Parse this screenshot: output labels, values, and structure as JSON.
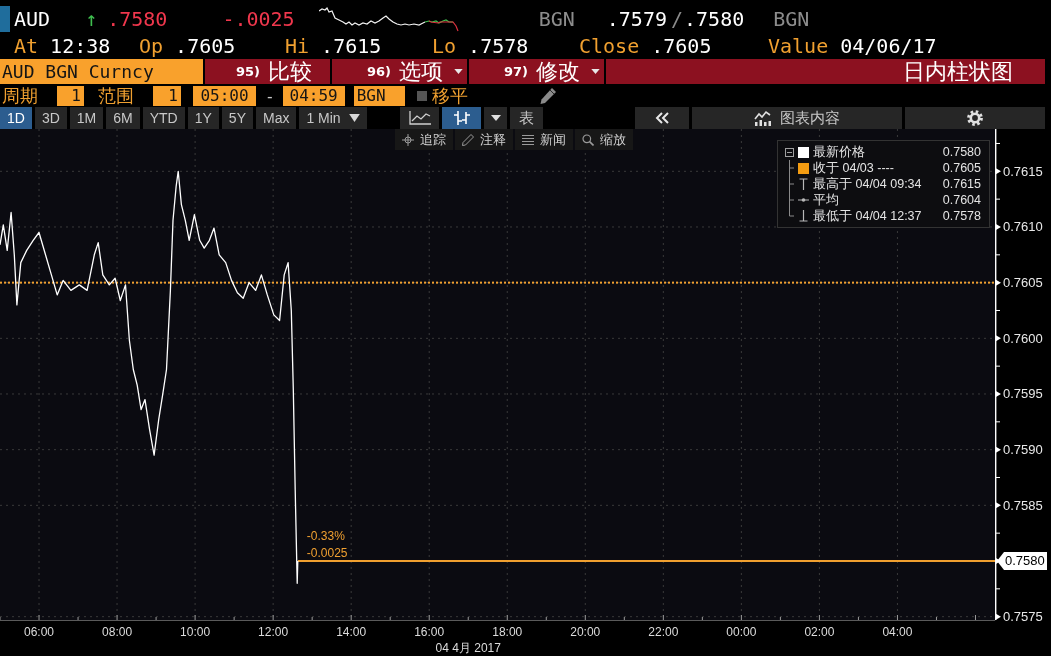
{
  "quote_header": {
    "ticker": "AUD",
    "trend_arrow": "↑",
    "last": ".7580",
    "change": "-.0025",
    "bid_source": "BGN",
    "bid": ".7579",
    "separator": "/",
    "ask": ".7580",
    "ask_source": "BGN"
  },
  "stats": [
    {
      "label": "At",
      "value": "12:38"
    },
    {
      "label": "Op",
      "value": ".7605"
    },
    {
      "label": "Hi",
      "value": ".7615"
    },
    {
      "label": "Lo",
      "value": ".7578"
    },
    {
      "label": "Close",
      "value": ".7605"
    },
    {
      "label": "Value",
      "value": "04/06/17"
    }
  ],
  "menu_bar": {
    "security": "AUD BGN Curncy",
    "actions": [
      {
        "number": "95)",
        "label": "比较",
        "dropdown": false
      },
      {
        "number": "96)",
        "label": "选项",
        "dropdown": true
      },
      {
        "number": "97)",
        "label": "修改",
        "dropdown": true
      }
    ],
    "title": "日内柱状图"
  },
  "settings_bar": {
    "period_label": "周期",
    "period": "1",
    "range_label": "范围",
    "range": "1",
    "start": "05:00",
    "separator": "-",
    "end": "04:59",
    "source": "BGN",
    "shift": {
      "label": "移平",
      "checked": false
    }
  },
  "toolbar": {
    "ranges": [
      {
        "label": "1D",
        "selected": true
      },
      {
        "label": "3D",
        "selected": false
      },
      {
        "label": "1M",
        "selected": false
      },
      {
        "label": "6M",
        "selected": false
      },
      {
        "label": "YTD",
        "selected": false
      },
      {
        "label": "1Y",
        "selected": false
      },
      {
        "label": "5Y",
        "selected": false
      },
      {
        "label": "Max",
        "selected": false
      }
    ],
    "interval": "1 Min",
    "chart_types": [
      {
        "kind": "line",
        "selected": false
      },
      {
        "kind": "bars",
        "selected": true
      }
    ],
    "table": "表",
    "panel": "图表内容"
  },
  "tools": [
    {
      "kind": "track",
      "label": "追踪"
    },
    {
      "kind": "annotate",
      "label": "注释"
    },
    {
      "kind": "news",
      "label": "新闻"
    },
    {
      "kind": "zoom",
      "label": "缩放"
    }
  ],
  "legend": {
    "kind": "swatch",
    "color": "#ffffff",
    "label": "最新价格",
    "value": "0.7580",
    "expanded": true,
    "children": [
      {
        "kind": "swatch",
        "color": "#f39c12",
        "label": "收于 04/03 ----",
        "value": "0.7605"
      },
      {
        "kind": "high",
        "label": "最高于 04/04 09:34",
        "value": "0.7615"
      },
      {
        "kind": "average",
        "label": "平均",
        "value": "0.7604"
      },
      {
        "kind": "low",
        "label": "最低于 04/04 12:37",
        "value": "0.7578"
      }
    ]
  },
  "chart": {
    "chart_data": {
      "type": "line",
      "xlabel": "04 4月 2017",
      "x": [
        "2017-04-04 05:00",
        "2017-04-04 05:05",
        "2017-04-04 05:11",
        "2017-04-04 05:17",
        "2017-04-04 05:22",
        "2017-04-04 05:26",
        "2017-04-04 05:32",
        "2017-04-04 05:41",
        "2017-04-04 05:51",
        "2017-04-04 06:00",
        "2017-04-04 06:10",
        "2017-04-04 06:19",
        "2017-04-04 06:28",
        "2017-04-04 06:37",
        "2017-04-04 06:49",
        "2017-04-04 07:02",
        "2017-04-04 07:14",
        "2017-04-04 07:25",
        "2017-04-04 07:31",
        "2017-04-04 07:38",
        "2017-04-04 07:48",
        "2017-04-04 07:57",
        "2017-04-04 08:05",
        "2017-04-04 08:13",
        "2017-04-04 08:19",
        "2017-04-04 08:25",
        "2017-04-04 08:31",
        "2017-04-04 08:37",
        "2017-04-04 08:43",
        "2017-04-04 08:50",
        "2017-04-04 08:57",
        "2017-04-04 09:04",
        "2017-04-04 09:10",
        "2017-04-04 09:16",
        "2017-04-04 09:22",
        "2017-04-04 09:26",
        "2017-04-04 09:31",
        "2017-04-04 09:34",
        "2017-04-04 09:39",
        "2017-04-04 09:45",
        "2017-04-04 09:51",
        "2017-04-04 09:59",
        "2017-04-04 10:07",
        "2017-04-04 10:14",
        "2017-04-04 10:22",
        "2017-04-04 10:29",
        "2017-04-04 10:37",
        "2017-04-04 10:47",
        "2017-04-04 10:56",
        "2017-04-04 11:05",
        "2017-04-04 11:14",
        "2017-04-04 11:23",
        "2017-04-04 11:33",
        "2017-04-04 11:42",
        "2017-04-04 11:51",
        "2017-04-04 12:01",
        "2017-04-04 12:10",
        "2017-04-04 12:17",
        "2017-04-04 12:23",
        "2017-04-04 12:28",
        "2017-04-04 12:31",
        "2017-04-04 12:34",
        "2017-04-04 12:37",
        "2017-04-04 12:38"
      ],
      "series": [
        {
          "color": "#ffffff",
          "values": [
            0.76084,
            0.76102,
            0.76079,
            0.76113,
            0.76075,
            0.7603,
            0.76068,
            0.76079,
            0.76088,
            0.76095,
            0.76075,
            0.76057,
            0.76039,
            0.76052,
            0.76043,
            0.76048,
            0.76043,
            0.76075,
            0.76086,
            0.76057,
            0.76048,
            0.76054,
            0.76034,
            0.76048,
            0.75998,
            0.75972,
            0.75958,
            0.75936,
            0.75945,
            0.75918,
            0.75895,
            0.75927,
            0.75949,
            0.75972,
            0.76043,
            0.76106,
            0.76137,
            0.7615,
            0.7612,
            0.76106,
            0.76088,
            0.76111,
            0.76088,
            0.76081,
            0.76088,
            0.76099,
            0.76075,
            0.76068,
            0.76052,
            0.76041,
            0.76036,
            0.7605,
            0.76043,
            0.76057,
            0.76039,
            0.76021,
            0.76016,
            0.76057,
            0.76068,
            0.76025,
            0.75954,
            0.75864,
            0.7578,
            0.758
          ]
        }
      ],
      "xlim": [
        "2017-04-04 05:00",
        "2017-04-05 06:30"
      ],
      "ylim": [
        0.75747,
        0.76188
      ],
      "xticks": [
        {
          "value": "2017-04-04 06:00",
          "label": "06:00"
        },
        {
          "value": "2017-04-04 08:00",
          "label": "08:00"
        },
        {
          "value": "2017-04-04 10:00",
          "label": "10:00"
        },
        {
          "value": "2017-04-04 12:00",
          "label": "12:00"
        },
        {
          "value": "2017-04-04 14:00",
          "label": "14:00"
        },
        {
          "value": "2017-04-04 16:00",
          "label": "16:00"
        },
        {
          "value": "2017-04-04 18:00",
          "label": "18:00"
        },
        {
          "value": "2017-04-04 20:00",
          "label": "20:00"
        },
        {
          "value": "2017-04-04 22:00",
          "label": "22:00"
        },
        {
          "value": "2017-04-05 00:00",
          "label": "00:00"
        },
        {
          "value": "2017-04-05 02:00",
          "label": "02:00"
        },
        {
          "value": "2017-04-05 04:00",
          "label": "04:00"
        }
      ],
      "yticks": [
        {
          "value": 0.7575,
          "label": "0.7575"
        },
        {
          "value": 0.7585,
          "label": "0.7585"
        },
        {
          "value": 0.759,
          "label": "0.7590"
        },
        {
          "value": 0.7595,
          "label": "0.7595"
        },
        {
          "value": 0.76,
          "label": "0.7600"
        },
        {
          "value": 0.7605,
          "label": "0.7605"
        },
        {
          "value": 0.761,
          "label": "0.7610"
        },
        {
          "value": 0.7615,
          "label": "0.7615"
        }
      ],
      "grid": true,
      "ref_lines": [
        {
          "axis": "y",
          "value": 0.7605
        },
        {
          "axis": "y",
          "value": 0.758
        }
      ],
      "annotations": [
        {
          "text": "-0.33%",
          "x": "2017-04-04 12:38",
          "y": 0.75822
        },
        {
          "text": "-0.0025",
          "x": "2017-04-04 12:38",
          "y": 0.75807
        },
        "0.7580"
      ]
    }
  }
}
